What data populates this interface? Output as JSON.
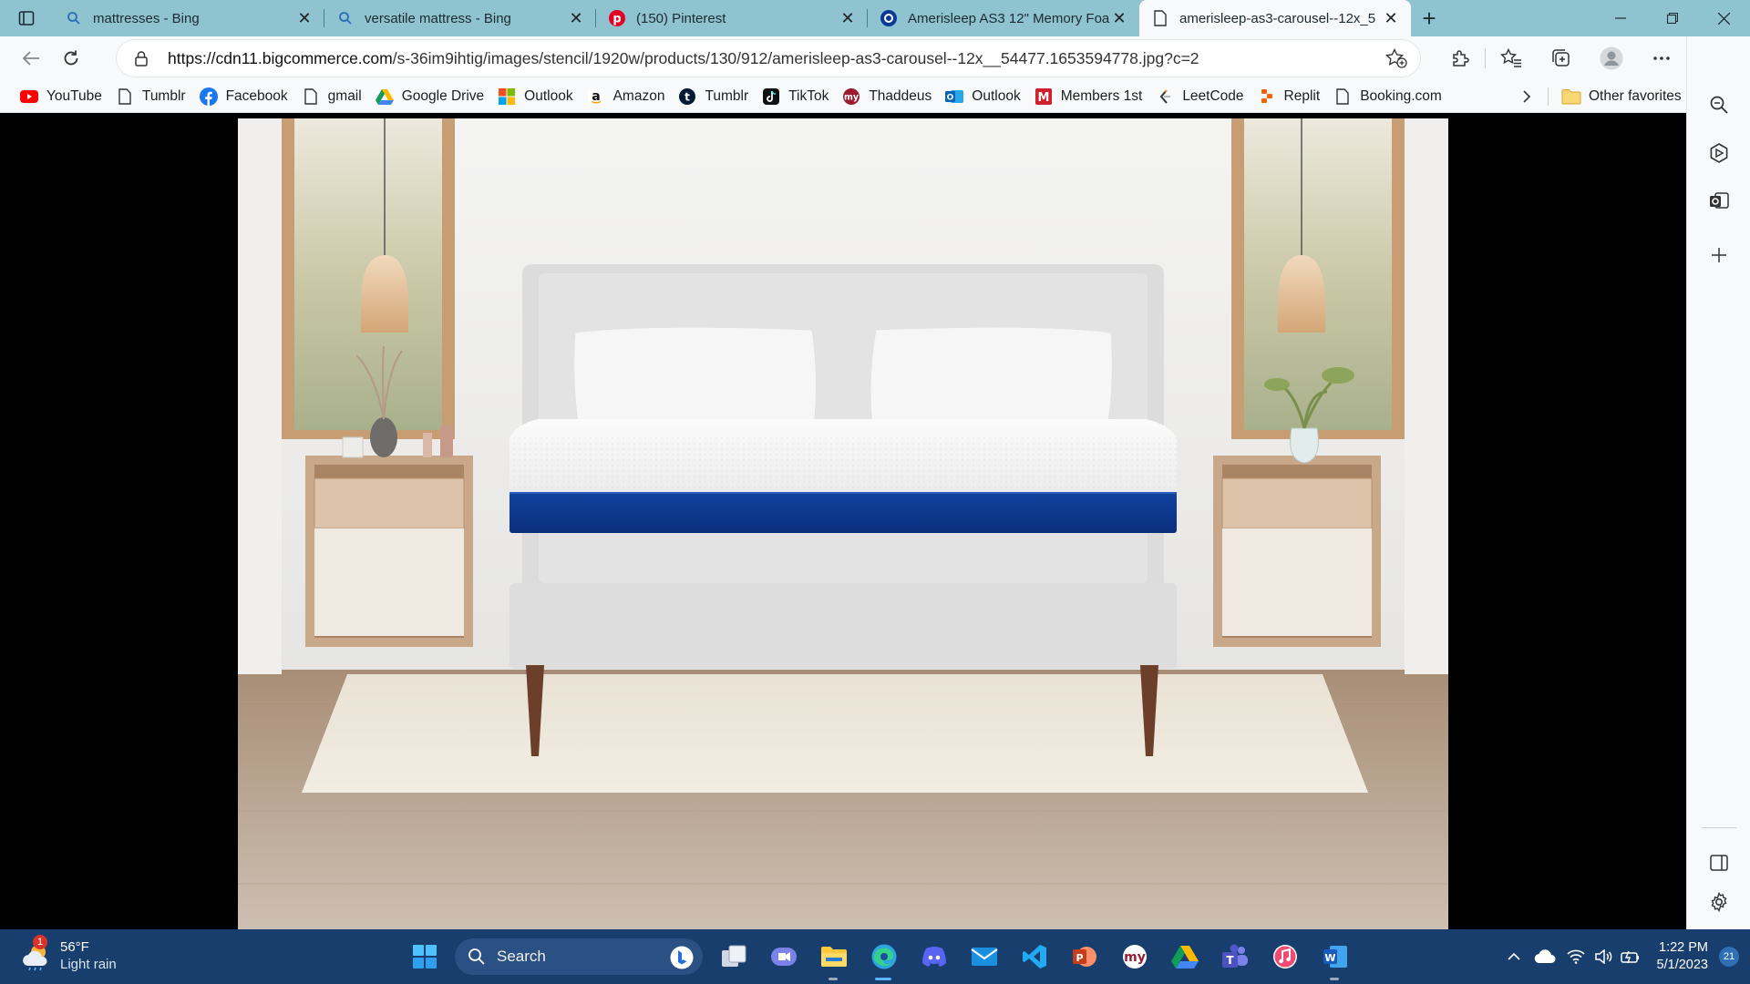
{
  "tabs": [
    {
      "title": "mattresses - Bing",
      "icon": "search-icon"
    },
    {
      "title": "versatile mattress - Bing",
      "icon": "search-icon"
    },
    {
      "title": "(150) Pinterest",
      "icon": "pinterest-icon"
    },
    {
      "title": "Amerisleep AS3 12\" Memory Foa",
      "icon": "amerisleep-icon"
    },
    {
      "title": "amerisleep-as3-carousel--12x_5",
      "icon": "page-icon",
      "active": true
    }
  ],
  "address": {
    "host": "https://cdn11.bigcommerce.com",
    "path": "/s-36im9ihtig/images/stencil/1920w/products/130/912/amerisleep-as3-carousel--12x__54477.1653594778.jpg?c=2"
  },
  "favorites": [
    {
      "label": "YouTube",
      "icon": "youtube-icon"
    },
    {
      "label": "Tumblr",
      "icon": "page-icon"
    },
    {
      "label": "Facebook",
      "icon": "facebook-icon"
    },
    {
      "label": "gmail",
      "icon": "page-icon"
    },
    {
      "label": "Google Drive",
      "icon": "google-drive-icon"
    },
    {
      "label": "Outlook",
      "icon": "windows-icon"
    },
    {
      "label": "Amazon",
      "icon": "amazon-icon"
    },
    {
      "label": "Tumblr",
      "icon": "tumblr-icon"
    },
    {
      "label": "TikTok",
      "icon": "tiktok-icon"
    },
    {
      "label": "Thaddeus",
      "icon": "mymath-icon"
    },
    {
      "label": "Outlook",
      "icon": "outlook-icon"
    },
    {
      "label": "Members 1st",
      "icon": "members1st-icon"
    },
    {
      "label": "LeetCode",
      "icon": "leetcode-icon"
    },
    {
      "label": "Replit",
      "icon": "replit-icon"
    },
    {
      "label": "Booking.com",
      "icon": "page-icon"
    }
  ],
  "favorites_other": "Other favorites",
  "weather": {
    "temp": "56°F",
    "condition": "Light rain",
    "badge": "1"
  },
  "taskbar": {
    "search_label": "Search"
  },
  "clock": {
    "time": "1:22 PM",
    "date": "5/1/2023"
  },
  "notifications": "21",
  "colors": {
    "tabstrip": "#8ec3cf",
    "taskbar": "#173e6d",
    "mattress_band": "#0b3a94",
    "accent": "#1a73e8"
  }
}
